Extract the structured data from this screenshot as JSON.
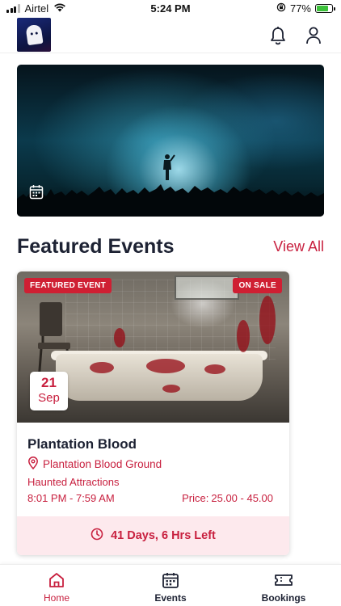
{
  "status_bar": {
    "carrier": "Airtel",
    "time": "5:24 PM",
    "battery": "77%",
    "battery_level": 0.77,
    "icons": [
      "signal-icon",
      "wifi-icon",
      "lock-rotation-icon",
      "battery-charging-icon"
    ]
  },
  "header": {
    "logo_icon": "ghost-logo-icon",
    "notification_icon": "bell-icon",
    "profile_icon": "user-icon"
  },
  "hero": {
    "calendar_icon": "calendar-icon"
  },
  "featured": {
    "title": "Featured Events",
    "view_all": "View All"
  },
  "event": {
    "featured_badge": "FEATURED EVENT",
    "sale_badge": "ON SALE",
    "date_day": "21",
    "date_month": "Sep",
    "name": "Plantation Blood",
    "venue": "Plantation Blood Ground",
    "venue_icon": "location-pin-icon",
    "category": "Haunted Attractions",
    "time_range": "8:01 PM - 7:59 AM",
    "price_label": "Price:",
    "price_range": "25.00 - 45.00",
    "countdown": "41 Days, 6 Hrs Left",
    "countdown_icon": "clock-icon"
  },
  "tabs": [
    {
      "label": "Home",
      "icon": "home-icon",
      "active": true
    },
    {
      "label": "Events",
      "icon": "calendar-icon",
      "active": false
    },
    {
      "label": "Bookings",
      "icon": "ticket-icon",
      "active": false
    }
  ],
  "colors": {
    "accent": "#c8203f",
    "badge": "#cf1f33",
    "countdown_bg": "#fde9ed",
    "text_dark": "#1d2233"
  }
}
